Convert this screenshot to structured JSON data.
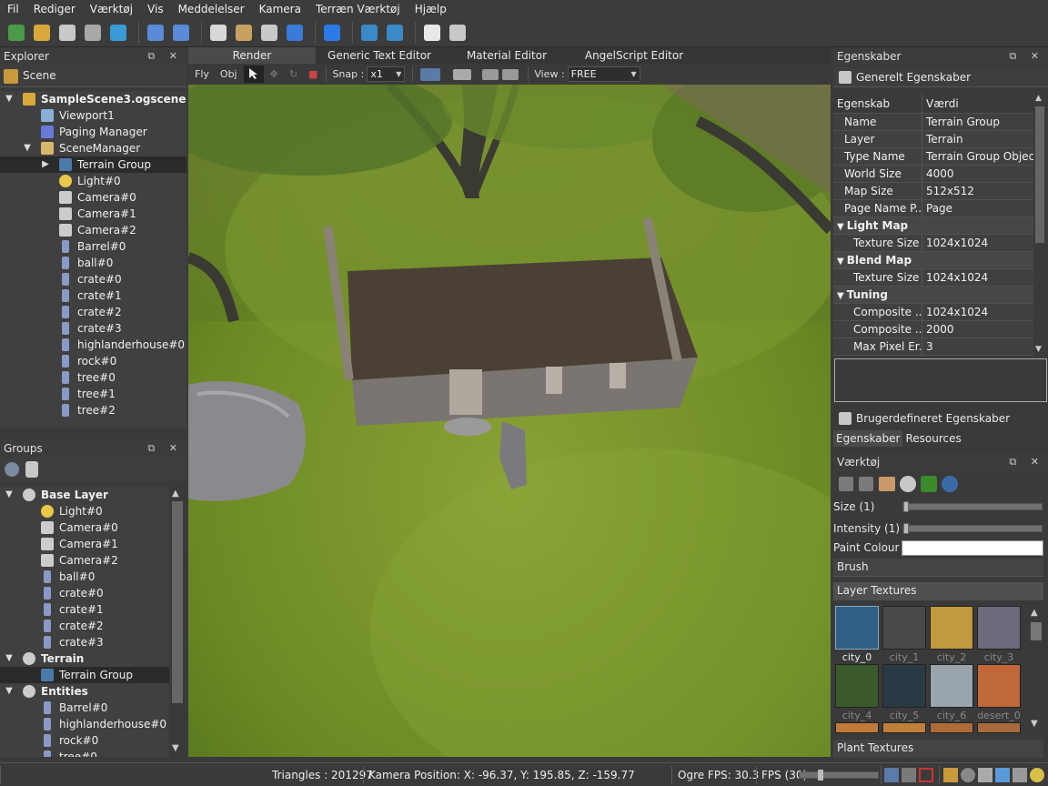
{
  "menu": [
    "Fil",
    "Rediger",
    "Værktøj",
    "Vis",
    "Meddelelser",
    "Kamera",
    "Terræn Værktøj",
    "Hjælp"
  ],
  "toolbar_icons": [
    "globe-icon",
    "open-folder-icon",
    "save-icon",
    "save-all-icon",
    "close-icon",
    "undo-icon",
    "redo-icon",
    "export-icon",
    "tools-icon",
    "layers-icon",
    "help-icon",
    "add-icon",
    "play-icon",
    "stop-icon",
    "editor-icon",
    "zoom-icon"
  ],
  "explorer": {
    "title": "Explorer",
    "header": "Scene",
    "items": [
      {
        "label": "SampleScene3.ogscene",
        "icon": "scene-icon",
        "level": 0,
        "bold": true,
        "arrow": "▼"
      },
      {
        "label": "Viewport1",
        "icon": "viewport-icon",
        "level": 1
      },
      {
        "label": "Paging Manager",
        "icon": "grid-icon",
        "level": 1
      },
      {
        "label": "SceneManager",
        "icon": "scenemanager-icon",
        "level": 1,
        "arrow": "▼"
      },
      {
        "label": "Terrain Group",
        "icon": "terrain-icon",
        "level": 2,
        "arrow": "▶",
        "selected": true
      },
      {
        "label": "Light#0",
        "icon": "light-icon",
        "level": 2
      },
      {
        "label": "Camera#0",
        "icon": "camera-icon",
        "level": 2
      },
      {
        "label": "Camera#1",
        "icon": "camera-icon",
        "level": 2
      },
      {
        "label": "Camera#2",
        "icon": "camera-icon",
        "level": 2
      },
      {
        "label": "Barrel#0",
        "icon": "entity-icon",
        "level": 2
      },
      {
        "label": "ball#0",
        "icon": "entity-icon",
        "level": 2
      },
      {
        "label": "crate#0",
        "icon": "entity-icon",
        "level": 2
      },
      {
        "label": "crate#1",
        "icon": "entity-icon",
        "level": 2
      },
      {
        "label": "crate#2",
        "icon": "entity-icon",
        "level": 2
      },
      {
        "label": "crate#3",
        "icon": "entity-icon",
        "level": 2
      },
      {
        "label": "highlanderhouse#0",
        "icon": "entity-icon",
        "level": 2
      },
      {
        "label": "rock#0",
        "icon": "entity-icon",
        "level": 2
      },
      {
        "label": "tree#0",
        "icon": "entity-icon",
        "level": 2
      },
      {
        "label": "tree#1",
        "icon": "entity-icon",
        "level": 2
      },
      {
        "label": "tree#2",
        "icon": "entity-icon",
        "level": 2
      }
    ]
  },
  "groups": {
    "title": "Groups",
    "items": [
      {
        "label": "Base Layer",
        "icon": "eye-icon",
        "level": 0,
        "bold": true,
        "arrow": "▼"
      },
      {
        "label": "Light#0",
        "icon": "light-icon",
        "level": 1
      },
      {
        "label": "Camera#0",
        "icon": "camera-icon",
        "level": 1
      },
      {
        "label": "Camera#1",
        "icon": "camera-icon",
        "level": 1
      },
      {
        "label": "Camera#2",
        "icon": "camera-icon",
        "level": 1
      },
      {
        "label": "ball#0",
        "icon": "entity-icon",
        "level": 1
      },
      {
        "label": "crate#0",
        "icon": "entity-icon",
        "level": 1
      },
      {
        "label": "crate#1",
        "icon": "entity-icon",
        "level": 1
      },
      {
        "label": "crate#2",
        "icon": "entity-icon",
        "level": 1
      },
      {
        "label": "crate#3",
        "icon": "entity-icon",
        "level": 1
      },
      {
        "label": "Terrain",
        "icon": "eye-icon",
        "level": 0,
        "bold": true,
        "arrow": "▼"
      },
      {
        "label": "Terrain Group",
        "icon": "terrain-icon",
        "level": 1,
        "selected": true
      },
      {
        "label": "Entities",
        "icon": "eye-icon",
        "level": 0,
        "bold": true,
        "arrow": "▼"
      },
      {
        "label": "Barrel#0",
        "icon": "entity-icon",
        "level": 1
      },
      {
        "label": "highlanderhouse#0",
        "icon": "entity-icon",
        "level": 1
      },
      {
        "label": "rock#0",
        "icon": "entity-icon",
        "level": 1
      },
      {
        "label": "tree#0",
        "icon": "entity-icon",
        "level": 1
      }
    ]
  },
  "tabs": [
    {
      "label": "Render",
      "active": true
    },
    {
      "label": "Generic Text Editor",
      "active": false
    },
    {
      "label": "Material Editor",
      "active": false
    },
    {
      "label": "AngelScript Editor",
      "active": false
    }
  ],
  "viewtb": {
    "fly": "Fly",
    "obj": "Obj",
    "snap_label": "Snap :",
    "snap_value": "x1",
    "view_label": "View :",
    "view_value": "FREE"
  },
  "properties": {
    "title": "Egenskaber",
    "general_header": "Generelt Egenskaber",
    "col_key": "Egenskab",
    "col_val": "Værdi",
    "rows": [
      {
        "type": "row",
        "k": "Name",
        "v": "Terrain Group"
      },
      {
        "type": "row",
        "k": "Layer",
        "v": "Terrain"
      },
      {
        "type": "row",
        "k": "Type Name",
        "v": "Terrain Group Object"
      },
      {
        "type": "row",
        "k": "World Size",
        "v": "4000"
      },
      {
        "type": "row",
        "k": "Map Size",
        "v": "512x512"
      },
      {
        "type": "row",
        "k": "Page Name P...",
        "v": "Page"
      },
      {
        "type": "group",
        "k": "Light Map"
      },
      {
        "type": "sub",
        "k": "Texture Size",
        "v": "1024x1024"
      },
      {
        "type": "group",
        "k": "Blend Map"
      },
      {
        "type": "sub",
        "k": "Texture Size",
        "v": "1024x1024"
      },
      {
        "type": "group",
        "k": "Tuning"
      },
      {
        "type": "sub",
        "k": "Composite ...",
        "v": "1024x1024"
      },
      {
        "type": "sub",
        "k": "Composite ...",
        "v": "2000"
      },
      {
        "type": "sub",
        "k": "Max Pixel Er...",
        "v": "3"
      }
    ],
    "custom_header": "Brugerdefineret Egenskaber",
    "tab1": "Egenskaber",
    "tab2": "Resources"
  },
  "tools": {
    "title": "Værktøj",
    "size_label": "Size (1)",
    "size_value": 0.01,
    "intensity_label": "Intensity (1)",
    "intensity_value": 0.01,
    "paint_label": "Paint Colour",
    "paint_color": "#ffffff",
    "brush_label": "Brush",
    "layer_label": "Layer Textures",
    "textures": [
      {
        "name": "city_0",
        "color": "#2f5f86"
      },
      {
        "name": "city_1",
        "color": "#4a4848"
      },
      {
        "name": "city_2",
        "color": "#c09a3e"
      },
      {
        "name": "city_3",
        "color": "#6a6a7a"
      },
      {
        "name": "city_4",
        "color": "#3a5a2a"
      },
      {
        "name": "city_5",
        "color": "#2a3a44"
      },
      {
        "name": "city_6",
        "color": "#9aa4ac"
      },
      {
        "name": "desert_0",
        "color": "#c0683a"
      }
    ],
    "plant_label": "Plant Textures"
  },
  "status": {
    "triangles": "Triangles : 201297",
    "camera": "Kamera Position: X: -96.37, Y:  195.85, Z: -159.77",
    "fps": "Ogre FPS: 30.3",
    "fps_limit": "FPS (30)"
  }
}
